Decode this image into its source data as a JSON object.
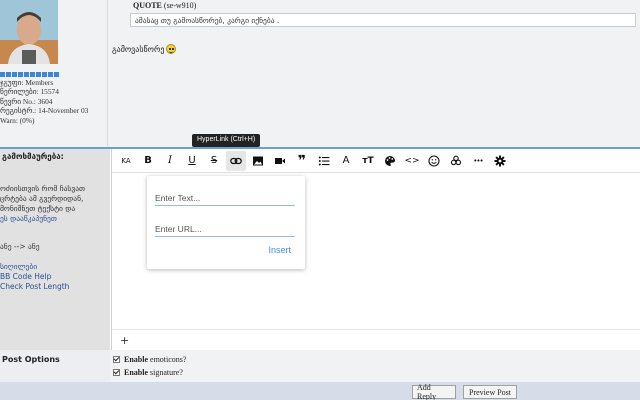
{
  "user": {
    "group": "ჯგუფი: Members",
    "posts": "წერილები: 15574",
    "member_no": "წევრი No.: 3604",
    "joined": "რეგისტრ.: 14-November 03",
    "warn": "Warn: (0%)"
  },
  "quote": {
    "label": "QUOTE",
    "author": "(se-w910)",
    "text": "ამასაც თუ გამოასწორებ, კარგი იქნება ."
  },
  "post_text": "გამოვასწორე",
  "tooltip": "HyperLink (Ctrl+H)",
  "form": {
    "message_label": "გამოხმაურება:",
    "help_lines": [
      "ოძიისთვის რომ ჩასვათ",
      "ცრტება ამ გვერდიდან,",
      "მონიშნეთ ტექსტი და",
      "ეს დააწკაპუნეთ"
    ],
    "help_line2": "ანე --> ანე",
    "links": [
      "სიღილები",
      "BB Code Help",
      "Check Post Length"
    ]
  },
  "toolbar": {
    "font_size": "KA",
    "bold": "B",
    "italic": "I",
    "underline": "U",
    "strike": "S",
    "quote": "❞",
    "font": "A",
    "textsize": "тT",
    "code": "<>",
    "more": "•••"
  },
  "link_popup": {
    "text_placeholder": "Enter Text...",
    "url_placeholder": "Enter URL...",
    "insert_label": "Insert"
  },
  "editor_plus": "+",
  "options": {
    "label": "Post Options",
    "emoticons_bold": "Enable",
    "emoticons_rest": "emoticons?",
    "signature_bold": "Enable",
    "signature_rest": "signature?"
  },
  "buttons": {
    "add_reply": "Add Reply",
    "preview_post": "Preview Post"
  }
}
